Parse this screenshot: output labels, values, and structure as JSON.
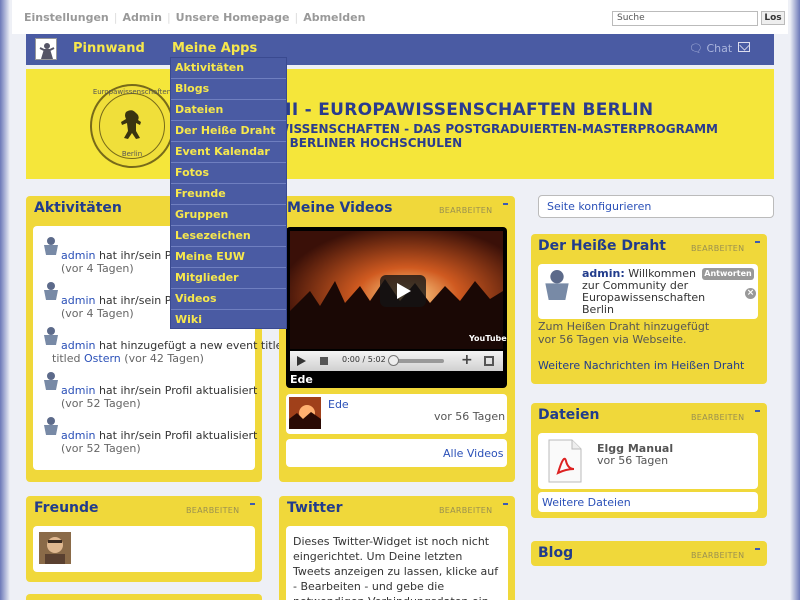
{
  "topbar": {
    "links": [
      "Einstellungen",
      "Admin",
      "Unsere Homepage",
      "Abmelden"
    ],
    "search_placeholder": "Suche",
    "search_button": "Los"
  },
  "navbar": {
    "items": [
      "Pinnwand",
      "Meine Apps"
    ],
    "chat": "Chat"
  },
  "menu": {
    "items": [
      "Aktivitäten",
      "Blogs",
      "Dateien",
      "Der Heiße Draht",
      "Event Kalendar",
      "Fotos",
      "Freunde",
      "Gruppen",
      "Lesezeichen",
      "Meine EUW",
      "Mitglieder",
      "Videos",
      "Wiki"
    ]
  },
  "banner": {
    "title": "ALUMNI - EUROPAWISSENSCHAFTEN BERLIN",
    "subtitle_1": "EUROPAWISSENSCHAFTEN - DAS POSTGRADUIERTEN-MASTERPROGRAMM",
    "subtitle_2": "DER DREI BERLINER HOCHSCHULEN",
    "seal_text_top": "Europawissenschaften",
    "seal_text_bottom": "Berlin"
  },
  "edit_label": "BEARBEITEN",
  "activities": {
    "title": "Aktivitäten",
    "rows": [
      {
        "user": "admin",
        "text": " hat ihr/sein Profil aktualisiert",
        "time": "(vor 4 Tagen)"
      },
      {
        "user": "admin",
        "text": " hat ihr/sein Profil aktualisiert",
        "time": "(vor 4 Tagen)"
      },
      {
        "user": "admin",
        "text": " hat hinzugefügt a new event titled ",
        "link": "Ostern",
        "time": "(vor 42 Tagen)"
      },
      {
        "user": "admin",
        "text": " hat ihr/sein Profil aktualisiert",
        "time": "(vor 52 Tagen)"
      },
      {
        "user": "admin",
        "text": " hat ihr/sein Profil aktualisiert",
        "time": "(vor 52 Tagen)"
      }
    ]
  },
  "friends": {
    "title": "Freunde"
  },
  "videos": {
    "title": "Meine Videos",
    "player_caption": "Ede",
    "time": "0:00 / 5:02",
    "youtube": "YouTube",
    "item_title": "Ede",
    "item_age": "vor 56 Tagen",
    "all_videos": "Alle Videos"
  },
  "twitter": {
    "title": "Twitter",
    "text": "Dieses Twitter-Widget ist noch nicht eingerichtet. Um Deine letzten Tweets anzeigen zu lassen, klicke auf - Bearbeiten - und gebe die notwendigen Verbindungsdaten ein"
  },
  "configure": "Seite konfigurieren",
  "hotwire": {
    "title": "Der Heiße Draht",
    "user": "admin:",
    "message": " Willkommen zur Community der Europawissenschaften Berlin",
    "reply": "Antworten",
    "added": "Zum Heißen Draht hinzugefügt vor 56 Tagen via Webseite.",
    "more": "Weitere Nachrichten im Heißen Draht"
  },
  "files": {
    "title": "Dateien",
    "file_name": "Elgg Manual",
    "file_age": "vor 56 Tagen",
    "more": "Weitere Dateien"
  },
  "blog": {
    "title": "Blog"
  }
}
